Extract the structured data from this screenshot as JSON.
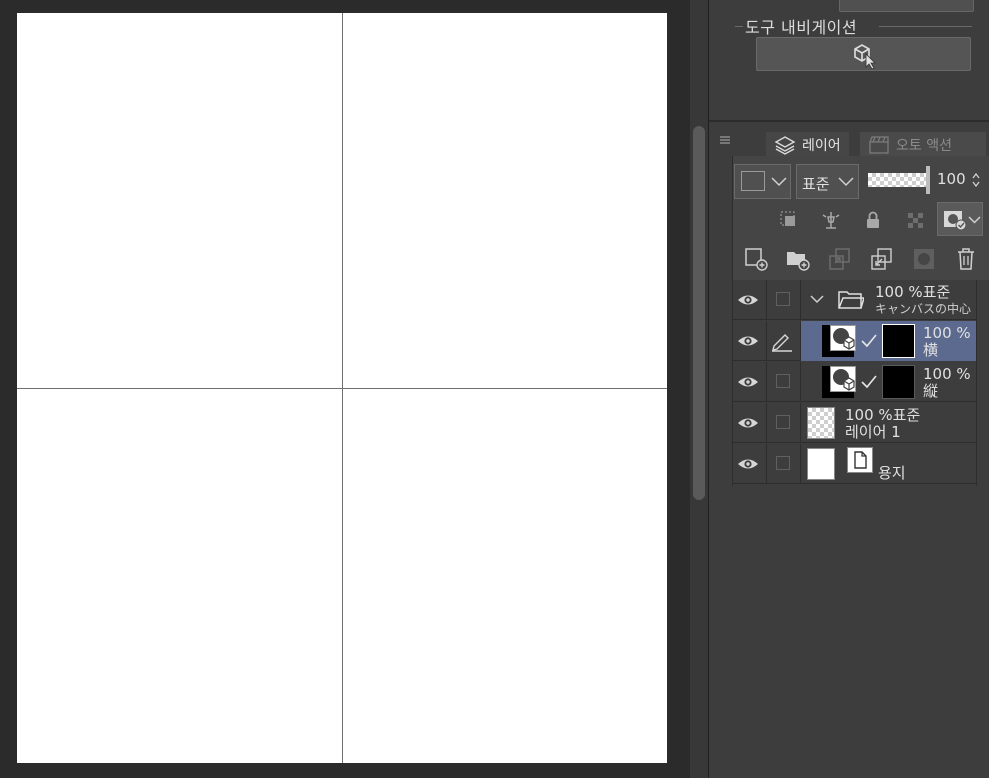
{
  "navigator": {
    "title": "도구 내비게이션"
  },
  "layer_panel": {
    "tabs": [
      {
        "label": "레이어",
        "icon": "layers-icon",
        "active": true
      },
      {
        "label": "오토 액션",
        "icon": "clapper-icon",
        "active": false
      }
    ],
    "blend_mode": "표준",
    "opacity": "100",
    "layers": [
      {
        "name_line1": "100 %표준",
        "name_line2": "キャンバスの中心",
        "type": "folder",
        "expanded": true
      },
      {
        "name_line1": "100 %",
        "name_line2": "横",
        "type": "ruler-layer",
        "selected": true,
        "editing": true
      },
      {
        "name_line1": "100 %",
        "name_line2": "縦",
        "type": "ruler-layer",
        "selected": false
      },
      {
        "name_line1": "100 %표준",
        "name_line2": "레이어 1",
        "type": "raster",
        "selected": false
      },
      {
        "name_line1": "",
        "name_line2": "용지",
        "type": "paper",
        "selected": false
      }
    ]
  },
  "colors": {
    "selected_row": "#5b6a8e",
    "panel_bg": "#3d3d3d",
    "canvas_bg": "#ffffff"
  }
}
